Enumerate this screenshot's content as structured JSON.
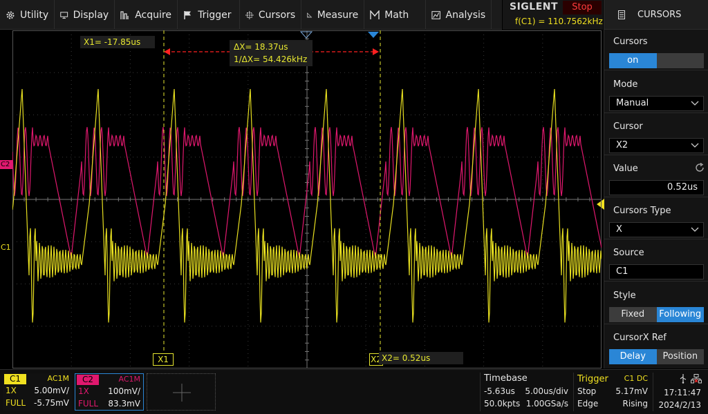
{
  "menu": {
    "items": [
      {
        "label": "Utility",
        "icon": "gear-icon"
      },
      {
        "label": "Display",
        "icon": "monitor-icon"
      },
      {
        "label": "Acquire",
        "icon": "acquire-icon"
      },
      {
        "label": "Trigger",
        "icon": "flag-icon"
      },
      {
        "label": "Cursors",
        "icon": "crosshair-icon"
      },
      {
        "label": "Measure",
        "icon": "ruler-icon"
      },
      {
        "label": "Math",
        "icon": "math-icon"
      },
      {
        "label": "Analysis",
        "icon": "analysis-icon"
      }
    ]
  },
  "brand": {
    "name": "SIGLENT",
    "run_status": "Stop",
    "frequency": "f(C1) = 110.7562kHz"
  },
  "panel": {
    "title": "CURSORS",
    "cursors": {
      "label": "Cursors",
      "on": "on",
      "off": ""
    },
    "mode": {
      "label": "Mode",
      "value": "Manual"
    },
    "cursor": {
      "label": "Cursor",
      "value": "X2"
    },
    "value": {
      "label": "Value",
      "value": "0.52us"
    },
    "cursors_type": {
      "label": "Cursors Type",
      "value": "X"
    },
    "source": {
      "label": "Source",
      "value": "C1"
    },
    "style": {
      "label": "Style",
      "fixed": "Fixed",
      "following": "Following"
    },
    "cursorx_ref": {
      "label": "CursorX Ref",
      "delay": "Delay",
      "position": "Position"
    }
  },
  "screen": {
    "x1_readout": "X1= -17.85us",
    "delta_x": "ΔX= 18.37us",
    "inv_delta_x": "1/ΔX= 54.426kHz",
    "x2_readout": "X2= 0.52us",
    "x1_tag": "X1",
    "x2_tag": "X2",
    "c1_marker": "C1",
    "c2_marker": "C2"
  },
  "colors": {
    "c1": "#e8e020",
    "c2": "#e0186e",
    "accent": "#2a86d6",
    "cursor": "#e8e830"
  },
  "channels": {
    "c1": {
      "name": "C1",
      "coupling": "AC1M",
      "probe": "1X",
      "scale": "5.00mV/",
      "bw": "FULL",
      "offset": "-5.75mV"
    },
    "c2": {
      "name": "C2",
      "coupling": "AC1M",
      "probe": "1X",
      "scale": "100mV/",
      "bw": "FULL",
      "offset": "83.3mV"
    }
  },
  "timebase": {
    "label": "Timebase",
    "delay": "-5.63us",
    "scale": "5.00us/div",
    "points": "50.0kpts",
    "rate": "1.00GSa/s"
  },
  "trigger": {
    "label": "Trigger",
    "source": "C1 DC",
    "state": "Stop",
    "level": "5.17mV",
    "type": "Edge",
    "slope": "Rising"
  },
  "clock": {
    "time": "17:11:47",
    "date": "2024/2/13"
  }
}
